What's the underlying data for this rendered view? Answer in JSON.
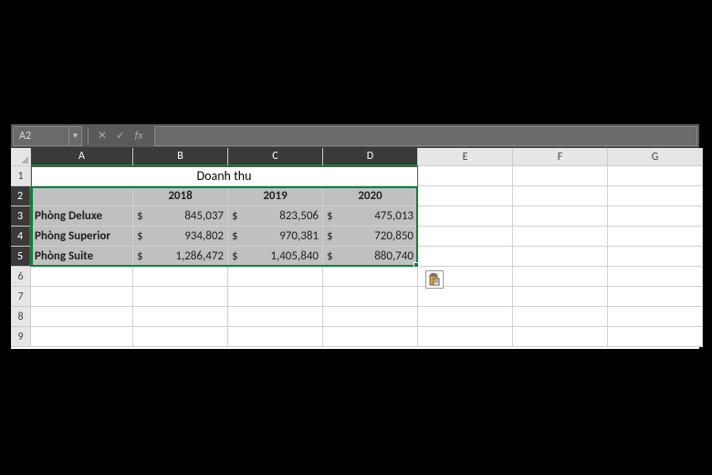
{
  "formula_bar": {
    "cell_ref": "A2",
    "fx_label": "fx",
    "input_value": ""
  },
  "columns": [
    "A",
    "B",
    "C",
    "D",
    "E",
    "F",
    "G"
  ],
  "rows": [
    "1",
    "2",
    "3",
    "4",
    "5",
    "6",
    "7",
    "8",
    "9"
  ],
  "sheet": {
    "title": "Doanh thu",
    "years": [
      "2018",
      "2019",
      "2020"
    ],
    "currency_symbol": "$",
    "row_labels": [
      "Phòng Deluxe",
      "Phòng Superior",
      "Phòng Suite"
    ],
    "values": [
      [
        "845,037",
        "823,506",
        "475,013"
      ],
      [
        "934,802",
        "970,381",
        "720,850"
      ],
      [
        "1,286,472",
        "1,405,840",
        "880,740"
      ]
    ]
  },
  "selection": {
    "ref": "A2:D5"
  },
  "icons": {
    "paste_options": "paste-options-icon"
  }
}
